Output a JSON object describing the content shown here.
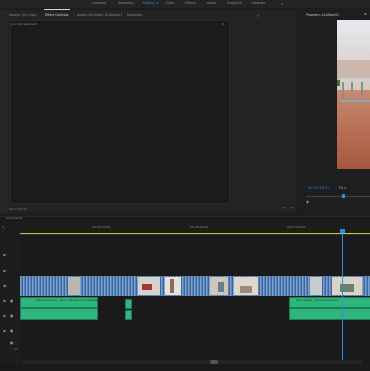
{
  "workspaces": {
    "items": [
      {
        "label": "Learning"
      },
      {
        "label": "Assembly"
      },
      {
        "label": "Editing"
      },
      {
        "label": "Color"
      },
      {
        "label": "Effects"
      },
      {
        "label": "Audio"
      },
      {
        "label": "Graphics"
      },
      {
        "label": "Libraries"
      }
    ],
    "active": "Editing"
  },
  "source_panel": {
    "tabs": [
      {
        "label": "Source: (no clips)"
      },
      {
        "label": "Effect Controls"
      },
      {
        "label": "Audio Clip Mixer: Al-Akbar01"
      },
      {
        "label": "Metadata"
      }
    ],
    "subtitle": "(no clip selected)",
    "bottom_timecode": "00:27:20:17"
  },
  "program_panel": {
    "title": "Program: Al-Akbar01",
    "timecode": "00:27:20:17"
  },
  "timeline": {
    "sequence_name": "Al-Akbar01",
    "ruler_times": [
      "00:26:20:00",
      "00:26:40:00",
      "00:27:00:00"
    ],
    "audio_clips": [
      {
        "label": "Vintage Garden - Kevin MacLeod (incompetech.com)"
      },
      {
        "label": "Jam Capital - Vlad Gluschenko"
      }
    ]
  },
  "colors": {
    "accent": "#2d8ceb",
    "video_clip": "#5a83b8",
    "audio_clip": "#2fb57e",
    "work_area": "#c9c436"
  }
}
